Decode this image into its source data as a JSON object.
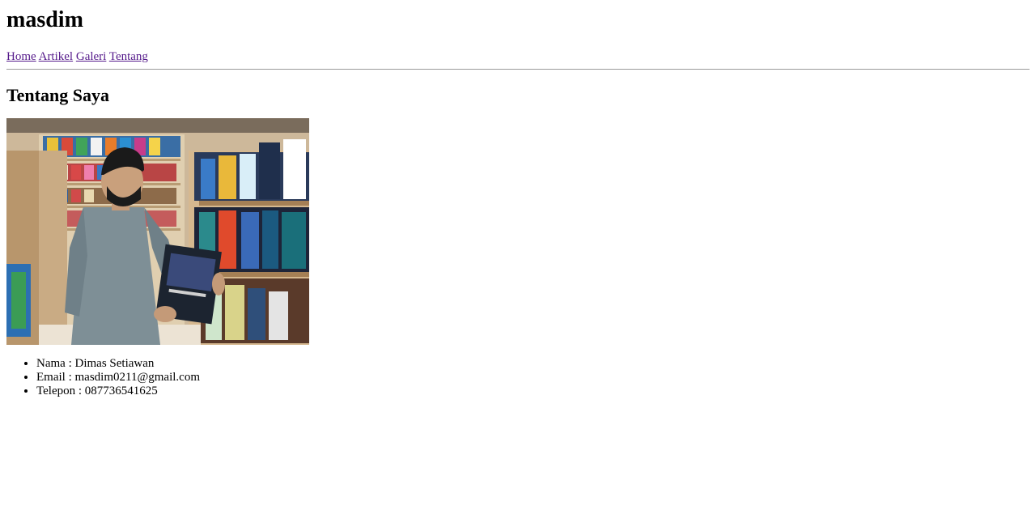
{
  "header": {
    "site_title": "masdim"
  },
  "nav": {
    "items": [
      "Home",
      "Artikel",
      "Galeri",
      "Tentang"
    ]
  },
  "main": {
    "section_title": "Tentang Saya",
    "info": [
      {
        "label": "Nama",
        "value": "Dimas Setiawan"
      },
      {
        "label": "Email",
        "value": "masdim0211@gmail.com"
      },
      {
        "label": "Telepon",
        "value": "087736541625"
      }
    ]
  },
  "colors": {
    "link_visited": "#551a8b",
    "divider": "#9a9a9a"
  }
}
